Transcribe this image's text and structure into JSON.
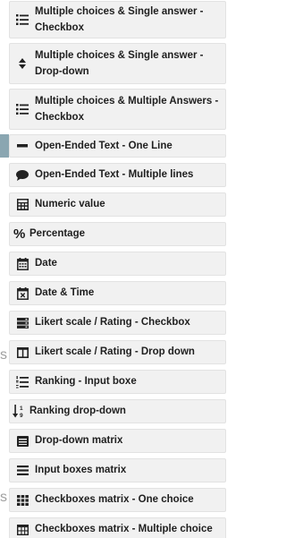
{
  "question_types": [
    {
      "label": "Multiple choices & Single answer - Checkbox",
      "icon": "list-icon"
    },
    {
      "label": "Multiple choices & Single answer - Drop-down",
      "icon": "sort-arrows-icon"
    },
    {
      "label": "Multiple choices & Multiple Answers - Checkbox",
      "icon": "list-icon"
    },
    {
      "label": "Open-Ended Text - One Line",
      "icon": "dash-icon"
    },
    {
      "label": "Open-Ended Text - Multiple lines",
      "icon": "speech-bubble-icon"
    },
    {
      "label": "Numeric value",
      "icon": "calculator-icon"
    },
    {
      "label": "Percentage",
      "icon": "percent-icon"
    },
    {
      "label": "Date",
      "icon": "calendar-icon"
    },
    {
      "label": "Date & Time",
      "icon": "calendar-x-icon"
    },
    {
      "label": "Likert scale / Rating - Checkbox",
      "icon": "server-stack-icon"
    },
    {
      "label": "Likert scale / Rating - Drop down",
      "icon": "columns-icon"
    },
    {
      "label": "Ranking - Input boxe",
      "icon": "numbered-list-icon"
    },
    {
      "label": "Ranking drop-down",
      "icon": "sort-numeric-icon"
    },
    {
      "label": "Drop-down matrix",
      "icon": "window-list-icon"
    },
    {
      "label": "Input boxes matrix",
      "icon": "bars-icon"
    },
    {
      "label": "Checkboxes matrix - One choice",
      "icon": "grid-icon"
    },
    {
      "label": "Checkboxes matrix - Multiple choice",
      "icon": "table-icon"
    }
  ],
  "background_fragments": [
    "s",
    "s"
  ]
}
